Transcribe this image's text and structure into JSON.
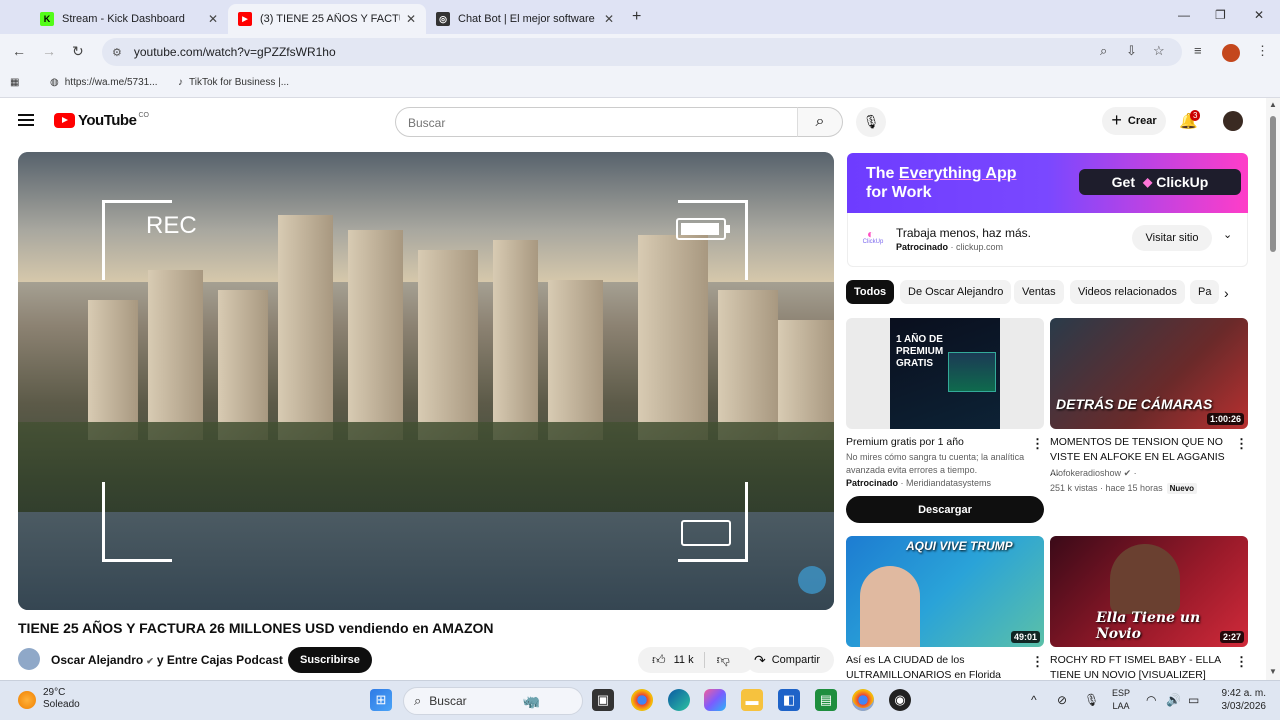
{
  "browser": {
    "tabs": [
      {
        "title": "Stream - Kick Dashboard",
        "close": "✕",
        "fav_color": "#53fc18",
        "fav_text": "K"
      },
      {
        "title": "(3) TIENE 25 AÑOS Y FACTURA",
        "close": "✕",
        "fav_color": "#ff0000",
        "fav_text": "▶"
      },
      {
        "title": "Chat Bot | El mejor software pa",
        "close": "✕",
        "fav_color": "#333333",
        "fav_text": "◎"
      }
    ],
    "new_tab": "+",
    "url": "youtube.com/watch?v=gPZZfsWR1ho",
    "bookmarks": [
      {
        "label": "https://wa.me/5731...",
        "icon": "globe-icon"
      },
      {
        "label": "TikTok for Business |...",
        "icon": "tiktok-icon"
      }
    ]
  },
  "youtube": {
    "logo_text": "YouTube",
    "country": "CO",
    "search_placeholder": "Buscar",
    "create_label": "Crear",
    "notif_count": "3"
  },
  "video": {
    "overlay_rec": "REC",
    "title": "TIENE 25 AÑOS Y FACTURA 26 MILLONES USD vendiendo en AMAZON",
    "channel": "Oscar Alejandro",
    "channel_suffix": "y Entre Cajas Podcast",
    "subscribe": "Suscribirse",
    "likes": "11 k",
    "share": "Compartir"
  },
  "ad": {
    "headline_1a": "The ",
    "headline_1b": "Everything App",
    "headline_2": "for Work",
    "cta_get": "Get",
    "cta_brand": "ClickUp",
    "logo_text": "ClickUp",
    "text": "Trabaja menos, haz más.",
    "sponsored": "Patrocinado",
    "domain": "clickup.com",
    "visit": "Visitar sitio"
  },
  "chips": [
    "Todos",
    "De Oscar Alejandro",
    "Ventas",
    "Videos relacionados",
    "Pa"
  ],
  "cards": [
    {
      "title": "Premium gratis por 1 año",
      "desc": "No mires cómo sangra tu cuenta; la analítica avanzada evita errores a tiempo.",
      "sponsored": "Patrocinado",
      "channel": "Meridiandatasystems",
      "thumb_text": "1 AÑO DE PREMIUM GRATIS",
      "cta": "Descargar"
    },
    {
      "title": "MOMENTOS DE TENSION QUE NO VISTE EN ALFOKE EN EL AGGANIS ...",
      "channel": "Alofokeradioshow",
      "views": "251 k vistas",
      "age": "hace 15 horas",
      "badge": "Nuevo",
      "duration": "1:00:26",
      "thumb_text": "DETRÁS DE CÁMARAS"
    },
    {
      "title": "Así es LA CIUDAD de los ULTRAMILLONARIOS en Florida",
      "duration": "49:01",
      "thumb_text": "AQUI VIVE TRUMP"
    },
    {
      "title": "ROCHY RD FT ISMEL BABY - ELLA TIENE UN NOVIO [VISUALIZER]",
      "duration": "2:27",
      "thumb_text": "Ella Tiene un Novio"
    }
  ],
  "taskbar": {
    "temp": "29°C",
    "weather": "Soleado",
    "search": "Buscar",
    "lang_1": "ESP",
    "lang_2": "LAA",
    "time": "9:42 a. m.",
    "date": "3/03/2026"
  }
}
